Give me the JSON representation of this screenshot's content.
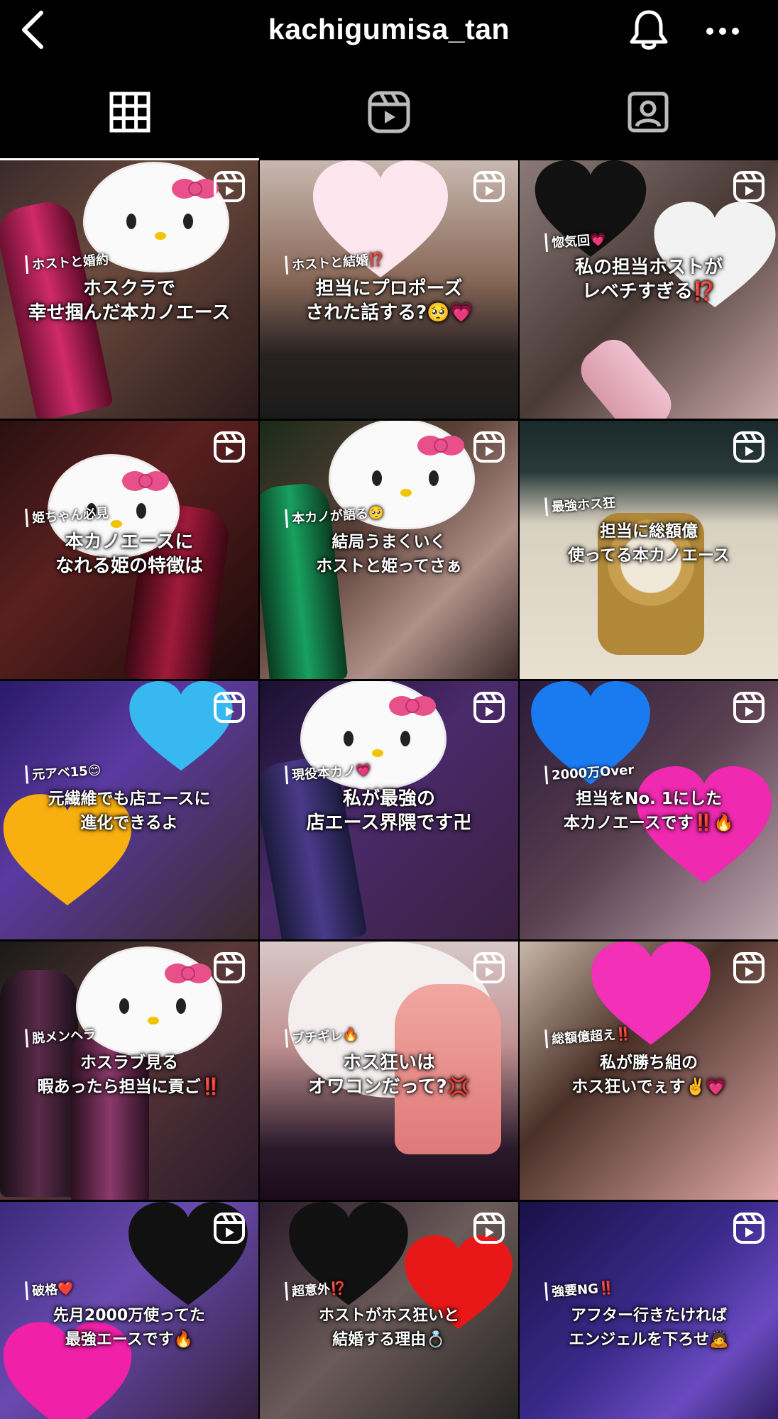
{
  "header": {
    "username": "kachigumisa_tan",
    "back_icon": "chevron-left-icon",
    "bell_icon": "bell-icon",
    "more_icon": "more-horizontal-icon"
  },
  "tabs": [
    {
      "name": "posts",
      "icon": "grid-icon",
      "active": true
    },
    {
      "name": "reels",
      "icon": "reels-icon",
      "active": false
    },
    {
      "name": "tagged",
      "icon": "tagged-icon",
      "active": false
    }
  ],
  "posts": [
    {
      "tag": "ホストと婚約",
      "line1": "ホスクラで",
      "line2": "幸せ掴んだ本カノエース"
    },
    {
      "tag": "ホストと結婚⁉️",
      "line1": "担当にプロポーズ",
      "line2": "された話する?🥺💗"
    },
    {
      "tag": "惚気回💗",
      "line1": "私の担当ホストが",
      "line2": "レベチすぎる⁉️"
    },
    {
      "tag": "姫ちゃん必見",
      "line1": "本カノエースに",
      "line2": "なれる姫の特徴は"
    },
    {
      "tag": "本カノが語る🥺",
      "line1": "結局うまくいく",
      "line2": "ホストと姫ってさぁ"
    },
    {
      "tag": "最強ホス狂",
      "line1": "担当に総額億",
      "line2": "使ってる本カノエース"
    },
    {
      "tag": "元アベ15😊",
      "line1": "元繊維でも店エースに",
      "line2": "進化できるよ"
    },
    {
      "tag": "現役本カノ💗",
      "line1": "私が最強の",
      "line2": "店エース界隈です卍"
    },
    {
      "tag": "2000万Over",
      "line1": "担当をNo. 1にした",
      "line2": "本カノエースです‼️🔥"
    },
    {
      "tag": "脱メンヘラ",
      "line1": "ホスラブ見る",
      "line2": "暇あったら担当に貢ご‼️"
    },
    {
      "tag": "ブチギレ🔥",
      "line1": "ホス狂いは",
      "line2": "オワコンだって?💢"
    },
    {
      "tag": "総額億超え‼️",
      "line1": "私が勝ち組の",
      "line2": "ホス狂いでぇす✌️💗"
    },
    {
      "tag": "破格❤️",
      "line1": "先月2000万使ってた",
      "line2": "最強エースです🔥"
    },
    {
      "tag": "超意外⁉️",
      "line1": "ホストがホス狂いと",
      "line2": "結婚する理由💍"
    },
    {
      "tag": "強要NG‼️",
      "line1": "アフター行きたければ",
      "line2": "エンジェルを下ろせ🙇"
    }
  ]
}
